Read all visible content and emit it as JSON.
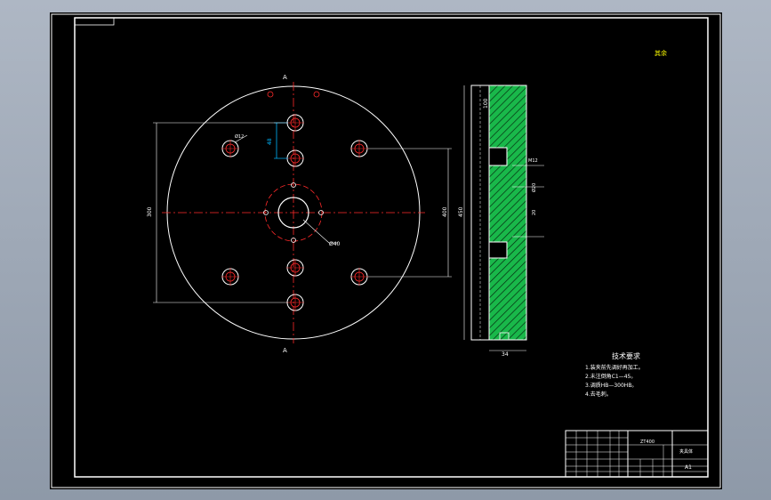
{
  "colors": {
    "line": "#ffffff",
    "center": "#ff2a2a",
    "dimension": "#00b7ff",
    "hatch": "#19b84a",
    "note": "#ffff00",
    "background": "#000000"
  },
  "drawing": {
    "section_mark_top": "A",
    "section_mark_bottom": "A",
    "dim_hole_spacing": "48",
    "dim_left_vertical": "300",
    "dim_right_vertical": "400",
    "dim_center_bore": "Ø40",
    "dim_small_hole": "Ø12",
    "dim_side_total": "450",
    "dim_side_offset": "100",
    "dim_side_thickness": "34",
    "dim_groove_a": "M12",
    "dim_groove_b": "Ø20",
    "dim_groove_c": "20",
    "corner_note": "其余"
  },
  "tech_requirements": {
    "title": "技术要求",
    "items": [
      "1.装夹前先调好再加工。",
      "2.未注倒角C1—45。",
      "3.调质HB—300HB。",
      "4.去毛刺。"
    ]
  },
  "title_block": {
    "drawing_name": "夹具体",
    "drawing_no": "A1",
    "part_code": "ZT400"
  }
}
